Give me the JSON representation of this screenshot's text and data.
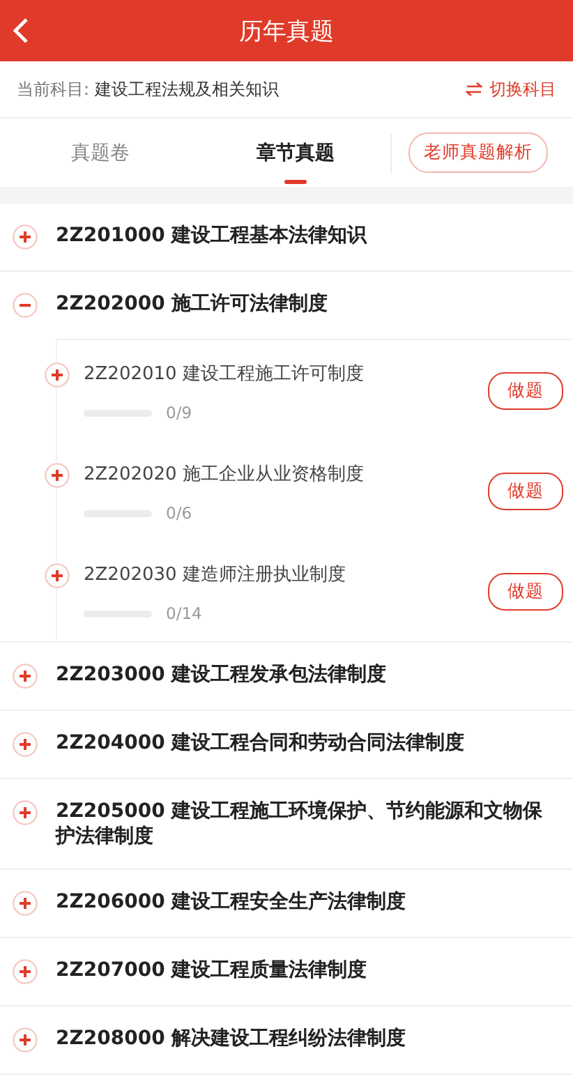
{
  "header": {
    "title": "历年真题"
  },
  "subject_bar": {
    "label": "当前科目:",
    "subject": "建设工程法规及相关知识",
    "switch_label": "切换科目"
  },
  "tabs": [
    {
      "label": "真题卷",
      "selected": false
    },
    {
      "label": "章节真题",
      "selected": true
    }
  ],
  "teacher_button": "老师真题解析",
  "chapters": [
    {
      "title": "2Z201000 建设工程基本法律知识",
      "expanded": false
    },
    {
      "title": "2Z202000 施工许可法律制度",
      "expanded": true,
      "children": [
        {
          "title": "2Z202010 建设工程施工许可制度",
          "expanded": false,
          "level": 0,
          "count": "0/9",
          "action": "做题"
        },
        {
          "title": "2Z202020 施工企业从业资格制度",
          "expanded": false,
          "level": 0,
          "count": "0/6",
          "action": "做题"
        },
        {
          "title": "2Z202030 建造师注册执业制度",
          "expanded": false,
          "level": 0,
          "count": "0/14",
          "action": "做题"
        }
      ]
    },
    {
      "title": "2Z203000 建设工程发承包法律制度",
      "expanded": false
    },
    {
      "title": "2Z204000 建设工程合同和劳动合同法律制度",
      "expanded": false
    },
    {
      "title": "2Z205000 建设工程施工环境保护、节约能源和文物保护法律制度",
      "expanded": false
    },
    {
      "title": "2Z206000 建设工程安全生产法律制度",
      "expanded": false
    },
    {
      "title": "2Z207000 建设工程质量法律制度",
      "expanded": false
    },
    {
      "title": "2Z208000 解决建设工程纠纷法律制度",
      "expanded": false
    }
  ]
}
